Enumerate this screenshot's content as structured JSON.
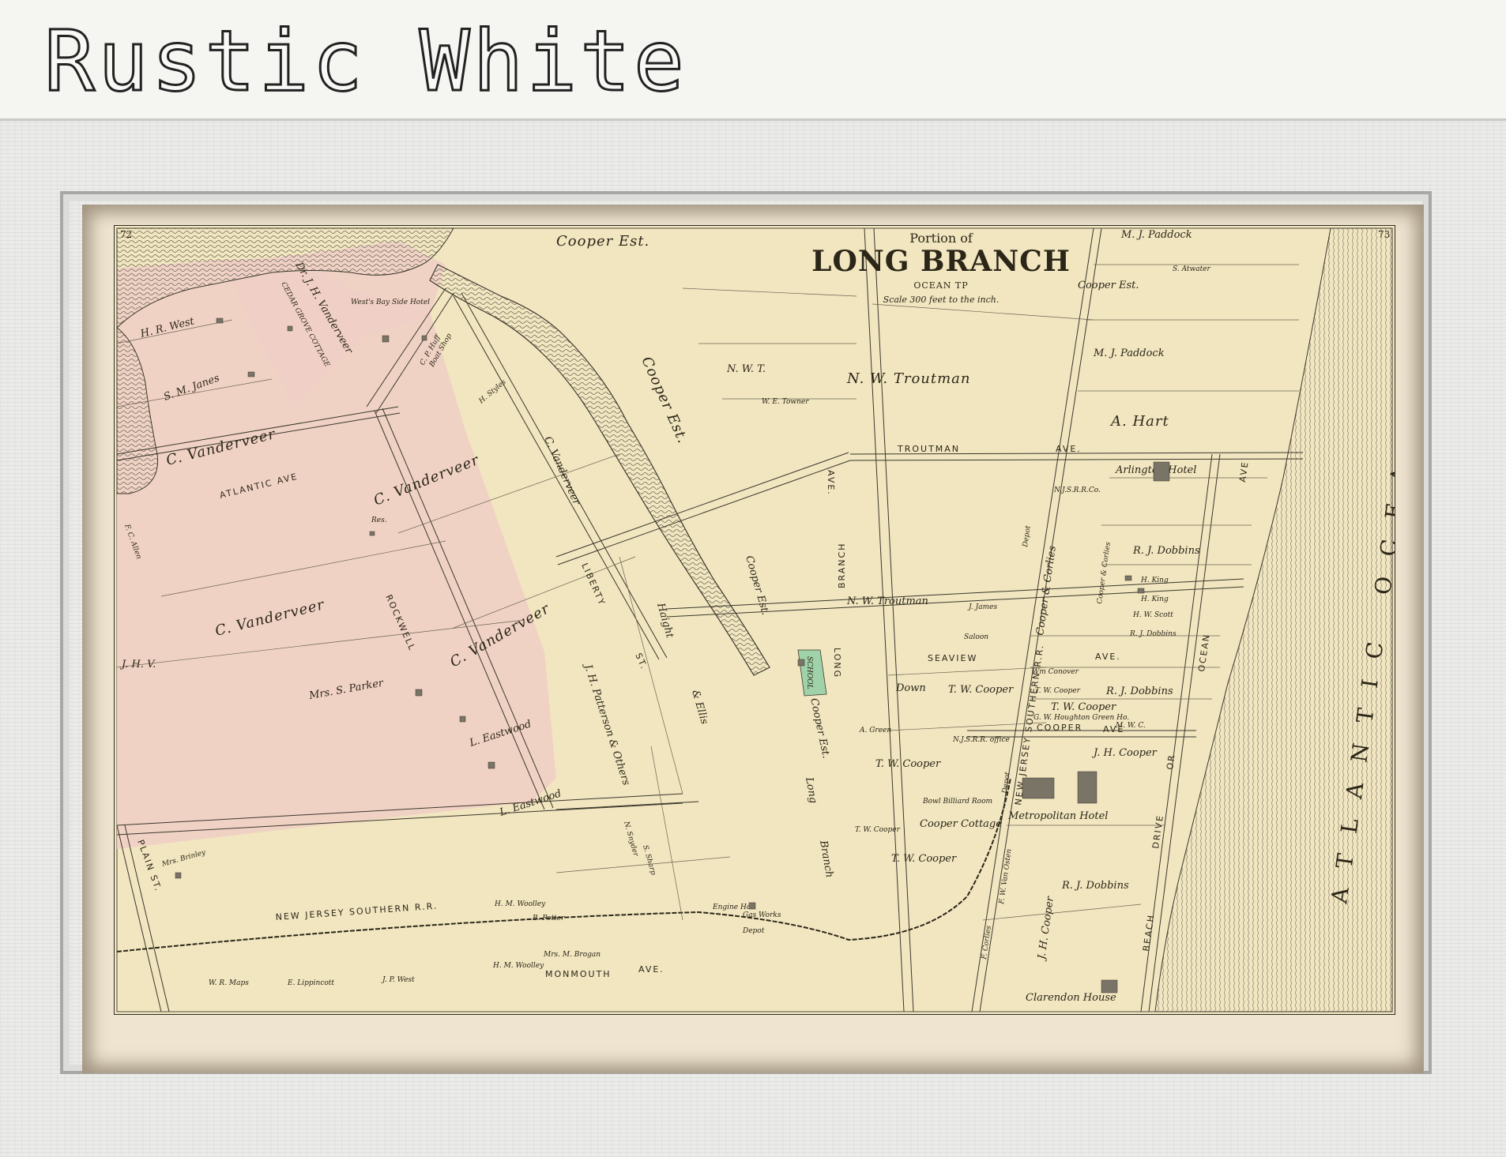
{
  "frame": {
    "title": "Rustic White"
  },
  "map": {
    "title_prefix": "Portion of",
    "title": "LONG BRANCH",
    "subtitle": "OCEAN TP",
    "scale": "Scale 300 feet to the inch.",
    "page_left": "72",
    "page_right": "73",
    "ocean": "ATLANTIC OCEAN",
    "streets": {
      "atlantic_ave": "ATLANTIC AVE",
      "troutman": "TROUTMAN",
      "troutman_ave": "AVE.",
      "seaview": "SEAVIEW",
      "seaview_ave": "AVE.",
      "cooper": "COOPER",
      "cooper_ave": "AVE",
      "monmouth": "MONMOUTH",
      "monmouth_ave": "AVE.",
      "rockwell": "ROCKWELL",
      "liberty": "LIBERTY",
      "st": "ST.",
      "plain": "PLAIN ST.",
      "railroad": "NEW JERSEY SOUTHERN R.R.",
      "long_branch_ave_1": "LONG",
      "long_branch_ave_2": "BRANCH",
      "ave": "AVE.",
      "ocean_ave": "OCEAN",
      "ocean_ave2": "AVE",
      "beach_or": "OR",
      "beach_drive": "DRIVE",
      "beach": "BEACH",
      "nj_rr": "NEW JERSEY SOUTHERN R.R."
    },
    "owners": {
      "hr_west": "H. R. West",
      "sm_janes": "S. M. Janes",
      "vanderveer_dr": "Dr. J. H. Vanderveer",
      "cedar_grove": "CEDAR GROVE COTTAGE",
      "bay_side": "West's Bay Side Hotel",
      "cooper_est_top": "Cooper Est.",
      "c_vanderveer_1": "C. Vanderveer",
      "c_vanderveer_2": "C. Vanderveer",
      "c_vanderveer_3": "C. Vanderveer",
      "c_vanderveer_4": "C. Vanderveer",
      "c_vanderveer_5": "C. Vanderveer",
      "fc_allen": "F. C. Allen",
      "jhv": "J. H. V.",
      "mrs_parker": "Mrs. S. Parker",
      "mrs_brinley": "Mrs. Brinley",
      "res": "Res.",
      "boat_shop": "Boat Shop",
      "cp_huff": "C. P. Huff",
      "h_styles": "H. Styles",
      "cooper_est_river": "Cooper Est.",
      "l_eastwood_1": "L. Eastwood",
      "l_eastwood_2": "L. Eastwood",
      "jh_patterson": "J. H. Patterson & Others",
      "haight_ellis_1": "Haight",
      "haight_ellis_2": "& Ellis",
      "nwt": "N. W. T.",
      "we_towner": "W. E. Towner",
      "nw_troutman_1": "N. W. Troutman",
      "nw_troutman_2": "N. W. Troutman",
      "mj_paddock_1": "M. J. Paddock",
      "mj_paddock_2": "M. J. Paddock",
      "s_atwater": "S. Atwater",
      "cooper_est_right": "Cooper Est.",
      "a_hart": "A. Hart",
      "arlington": "Arlington Hotel",
      "njsrr": "N.J.S.R.R.Co.",
      "rj_dobbins_1": "R. J. Dobbins",
      "rj_dobbins_2": "R. J. Dobbins",
      "rj_dobbins_3": "R. J. Dobbins",
      "rj_dobbins_4": "R. J. Dobbins",
      "h_king_1": "H. King",
      "h_king_2": "H. King",
      "hw_scott": "H. W. Scott",
      "cooper_corlies": "Cooper & Corlies",
      "cooper_corlies_2": "Cooper & Corlies",
      "school": "SCHOOL",
      "cooper_est_mid": "Cooper Est.",
      "saloon": "Saloon",
      "j_james": "J. James",
      "down": "Down",
      "tw_cooper_1": "T. W. Cooper",
      "tw_cooper_2": "T. W. Cooper",
      "tw_cooper_3": "T. W. Cooper",
      "tw_cooper_4": "T. W. Cooper",
      "tw_cooper_5": "T. W. Cooper",
      "tw_cooper_6": "T. W. Cooper",
      "a_green": "A. Green",
      "njsrr_office": "N.J.S.R.R. office",
      "bowling": "Bowl Billiard Room",
      "cooper_cottage": "Cooper Cottage",
      "metropolitan": "Metropolitan Hotel",
      "wm_conover": "Wm Conover",
      "houghton": "G. W. Houghton Green Ho.",
      "jh_cooper_1": "J. H. Cooper",
      "jh_cooper_2": "J. H. Cooper",
      "mwc": "M. W. C.",
      "depot_1": "Depot",
      "depot_2": "Depot",
      "depot_3": "Depot",
      "long_branch_creek_1": "Long",
      "long_branch_creek_2": "Branch",
      "cooper_est_low": "Cooper Est.",
      "fw_vanosten": "F. W. Van Osten",
      "corlies": "F. Corlies",
      "clarendon": "Clarendon House",
      "engine_ho": "Engine Ho.",
      "gas_works": "Gas Works",
      "s_sharp": "S. Sharp",
      "hm_woolley_1": "H. M. Woolley",
      "hm_woolley_2": "H. M. Woolley",
      "wr_maps": "W. R. Maps",
      "e_lippincott": "E. Lippincott",
      "jp_west": "J. P. West",
      "mrs_m_brogan": "Mrs. M. Brogan",
      "b_potter": "B. Potter",
      "n_snyder": "N. Snyder"
    }
  }
}
